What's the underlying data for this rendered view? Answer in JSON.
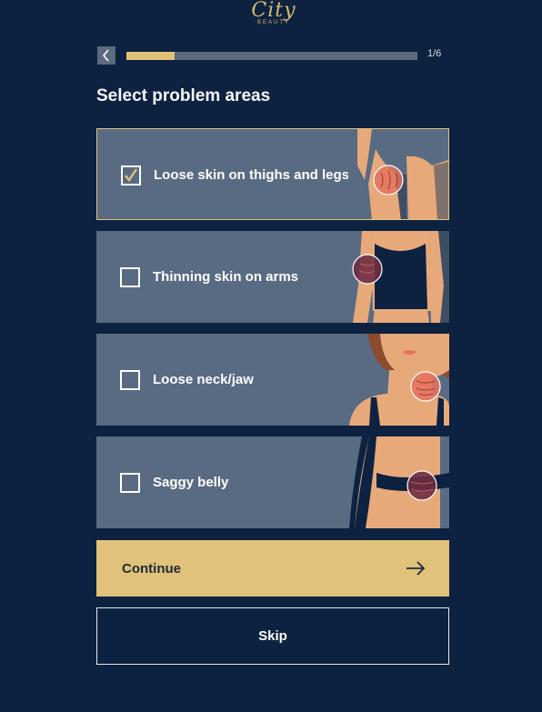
{
  "brand": {
    "name": "City",
    "sub": "BEAUTY"
  },
  "progress": {
    "current": 1,
    "total": 6,
    "label": "1/6",
    "fraction": 0.167
  },
  "heading": "Select problem areas",
  "options": [
    {
      "label": "Loose skin on thighs and legs",
      "checked": true
    },
    {
      "label": "Thinning skin on arms",
      "checked": false
    },
    {
      "label": "Loose neck/jaw",
      "checked": false
    },
    {
      "label": "Saggy belly",
      "checked": false
    }
  ],
  "continue": {
    "label": "Continue",
    "icon": "arrow-right-icon"
  },
  "skip": {
    "label": "Skip"
  },
  "colors": {
    "background": "#0d2240",
    "card": "#596b82",
    "accent": "#e0c27a",
    "skin": "#e7a97a",
    "highlight": "#e4735f"
  }
}
